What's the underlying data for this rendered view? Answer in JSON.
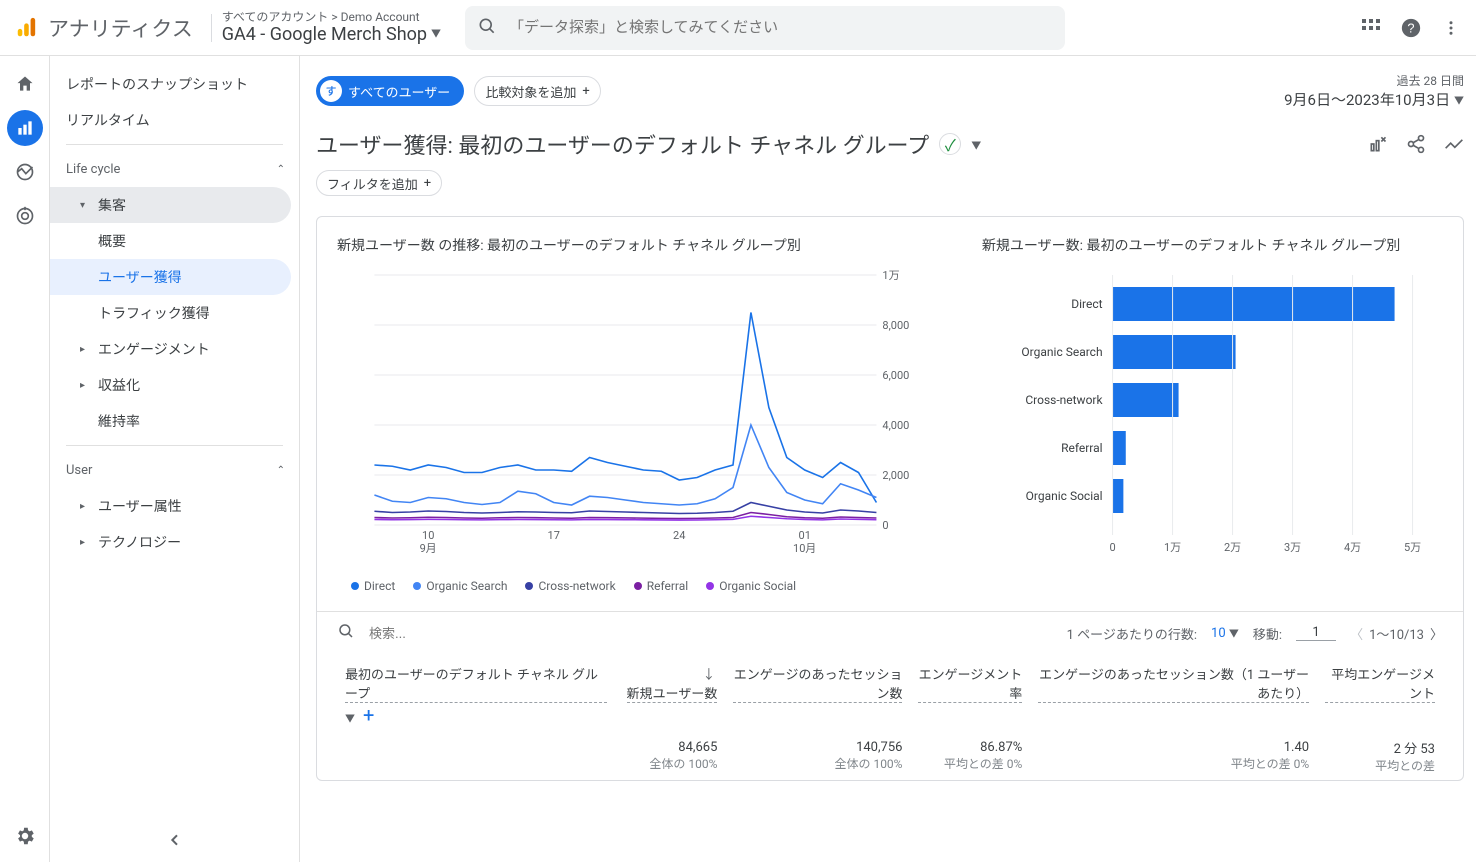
{
  "brand": "アナリティクス",
  "breadcrumb": "すべてのアカウント > Demo Account",
  "property_name": "GA4 - Google Merch Shop",
  "search_placeholder": "「データ探索」と検索してみてください",
  "sidebar": {
    "snapshot": "レポートのスナップショット",
    "realtime": "リアルタイム",
    "section_lifecycle": "Life cycle",
    "acquisition": "集客",
    "acq_overview": "概要",
    "acq_user": "ユーザー獲得",
    "acq_traffic": "トラフィック獲得",
    "engagement": "エンゲージメント",
    "monetization": "収益化",
    "retention": "維持率",
    "section_user": "User",
    "user_attr": "ユーザー属性",
    "technology": "テクノロジー"
  },
  "controls": {
    "all_users": "すべてのユーザー",
    "all_users_badge": "す",
    "add_compare": "比較対象を追加",
    "date_label": "過去 28 日間",
    "date_range": "9月6日～2023年10月3日",
    "add_filter": "フィルタを追加"
  },
  "page_title": "ユーザー獲得: 最初のユーザーのデフォルト チャネル グループ",
  "chart_left_title": "新規ユーザー数 の推移: 最初のユーザーのデフォルト チャネル グループ別",
  "chart_right_title": "新規ユーザー数: 最初のユーザーのデフォルト チャネル グループ別",
  "chart_data": [
    {
      "type": "line",
      "title": "新規ユーザー数 の推移: 最初のユーザーのデフォルト チャネル グループ別",
      "x_ticks": [
        "10\n9月",
        "17",
        "24",
        "01\n10月"
      ],
      "y_ticks": [
        "0",
        "2,000",
        "4,000",
        "6,000",
        "8,000",
        "1万"
      ],
      "ylim": [
        0,
        10000
      ],
      "series": [
        {
          "name": "Direct",
          "color": "#1a73e8",
          "values": [
            2400,
            2350,
            2200,
            2400,
            2300,
            2100,
            2100,
            2300,
            2400,
            2200,
            2200,
            2150,
            2700,
            2500,
            2350,
            2200,
            2150,
            1800,
            1900,
            2200,
            2400,
            8500,
            4700,
            2700,
            2200,
            1900,
            2500,
            2100,
            900
          ]
        },
        {
          "name": "Organic Search",
          "color": "#4285f4",
          "values": [
            1200,
            950,
            900,
            1100,
            1050,
            900,
            820,
            900,
            1350,
            1250,
            900,
            800,
            1150,
            1100,
            1000,
            900,
            850,
            800,
            850,
            1050,
            1500,
            4000,
            2300,
            1300,
            1000,
            850,
            1650,
            1400,
            1100
          ]
        },
        {
          "name": "Cross-network",
          "color": "#3740a4",
          "values": [
            550,
            500,
            520,
            560,
            540,
            500,
            480,
            500,
            530,
            520,
            500,
            490,
            560,
            540,
            520,
            500,
            480,
            460,
            470,
            500,
            550,
            900,
            750,
            600,
            520,
            480,
            600,
            560,
            500
          ]
        },
        {
          "name": "Referral",
          "color": "#7b1fa2",
          "values": [
            300,
            280,
            290,
            310,
            300,
            280,
            270,
            290,
            300,
            295,
            280,
            270,
            300,
            295,
            285,
            275,
            265,
            260,
            265,
            280,
            300,
            500,
            420,
            330,
            290,
            270,
            320,
            300,
            280
          ]
        },
        {
          "name": "Organic Social",
          "color": "#9334e6",
          "values": [
            220,
            210,
            215,
            225,
            220,
            210,
            205,
            215,
            220,
            218,
            210,
            205,
            220,
            218,
            212,
            208,
            202,
            198,
            200,
            210,
            225,
            350,
            300,
            250,
            220,
            205,
            240,
            225,
            210
          ]
        }
      ]
    },
    {
      "type": "bar",
      "title": "新規ユーザー数: 最初のユーザーのデフォルト チャネル グループ別",
      "orientation": "horizontal",
      "categories": [
        "Direct",
        "Organic Search",
        "Cross-network",
        "Referral",
        "Organic Social"
      ],
      "values": [
        47000,
        20500,
        11000,
        2200,
        1800
      ],
      "x_ticks": [
        "0",
        "1万",
        "2万",
        "3万",
        "4万",
        "5万"
      ],
      "xlim": [
        0,
        50000
      ],
      "color": "#1a73e8"
    }
  ],
  "legend": [
    {
      "label": "Direct",
      "color": "#1a73e8"
    },
    {
      "label": "Organic Search",
      "color": "#4285f4"
    },
    {
      "label": "Cross-network",
      "color": "#3740a4"
    },
    {
      "label": "Referral",
      "color": "#7b1fa2"
    },
    {
      "label": "Organic Social",
      "color": "#9334e6"
    }
  ],
  "table": {
    "search_placeholder": "検索...",
    "rows_per_page_label": "1 ページあたりの行数:",
    "rows_per_page_value": "10",
    "goto_label": "移動:",
    "goto_value": "1",
    "range": "1～10/13",
    "dim_header": "最初のユーザーのデフォルト チャネル グループ",
    "cols": [
      {
        "h": "新規ユーザー数",
        "total": "84,665",
        "sub": "全体の 100%"
      },
      {
        "h": "エンゲージのあったセッション数",
        "total": "140,756",
        "sub": "全体の 100%"
      },
      {
        "h": "エンゲージメント率",
        "total": "86.87%",
        "sub": "平均との差 0%"
      },
      {
        "h": "エンゲージのあったセッション数（1 ユーザーあたり）",
        "total": "1.40",
        "sub": "平均との差 0%"
      },
      {
        "h": "平均エンゲージメント",
        "total": "2 分 53",
        "sub": "平均との差"
      }
    ]
  }
}
